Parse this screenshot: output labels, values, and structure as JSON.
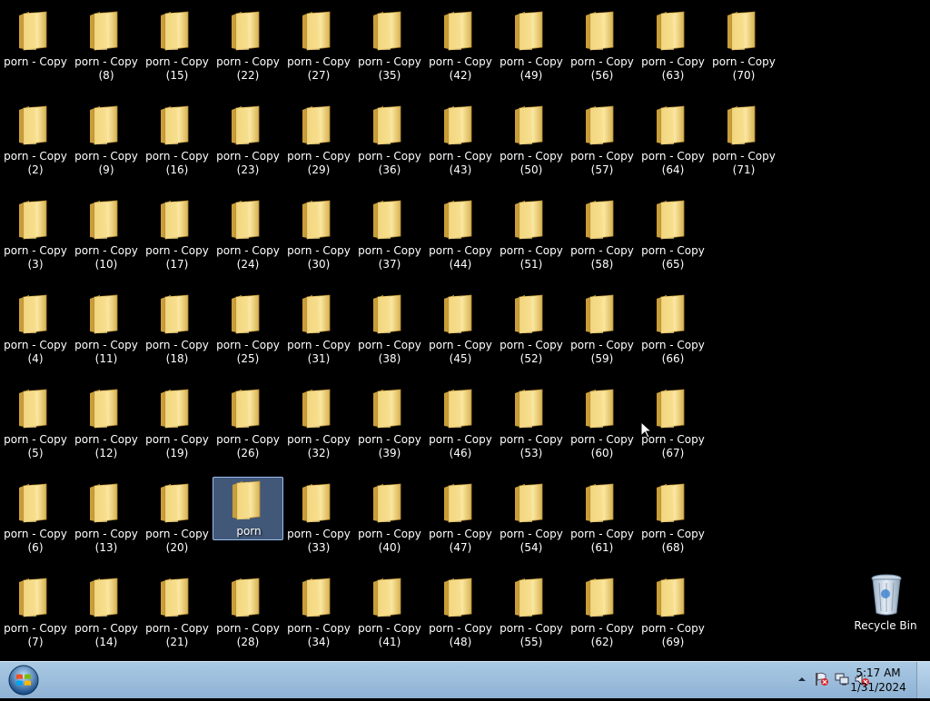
{
  "desktop": {
    "folder_icon": "folder-icon",
    "selected_label": "porn",
    "columns": [
      [
        "porn - Copy",
        "porn - Copy\n(2)",
        "porn - Copy\n(3)",
        "porn - Copy\n(4)",
        "porn - Copy\n(5)",
        "porn - Copy\n(6)",
        "porn - Copy\n(7)"
      ],
      [
        "porn - Copy\n(8)",
        "porn - Copy\n(9)",
        "porn - Copy\n(10)",
        "porn - Copy\n(11)",
        "porn - Copy\n(12)",
        "porn - Copy\n(13)",
        "porn - Copy\n(14)"
      ],
      [
        "porn - Copy\n(15)",
        "porn - Copy\n(16)",
        "porn - Copy\n(17)",
        "porn - Copy\n(18)",
        "porn - Copy\n(19)",
        "porn - Copy\n(20)",
        "porn - Copy\n(21)"
      ],
      [
        "porn - Copy\n(22)",
        "porn - Copy\n(23)",
        "porn - Copy\n(24)",
        "porn - Copy\n(25)",
        "porn - Copy\n(26)",
        "porn",
        "porn - Copy\n(28)"
      ],
      [
        "porn - Copy\n(27)",
        "porn - Copy\n(29)",
        "porn - Copy\n(30)",
        "porn - Copy\n(31)",
        "porn - Copy\n(32)",
        "porn - Copy\n(33)",
        "porn - Copy\n(34)"
      ],
      [
        "porn - Copy\n(35)",
        "porn - Copy\n(36)",
        "porn - Copy\n(37)",
        "porn - Copy\n(38)",
        "porn - Copy\n(39)",
        "porn - Copy\n(40)",
        "porn - Copy\n(41)"
      ],
      [
        "porn - Copy\n(42)",
        "porn - Copy\n(43)",
        "porn - Copy\n(44)",
        "porn - Copy\n(45)",
        "porn - Copy\n(46)",
        "porn - Copy\n(47)",
        "porn - Copy\n(48)"
      ],
      [
        "porn - Copy\n(49)",
        "porn - Copy\n(50)",
        "porn - Copy\n(51)",
        "porn - Copy\n(52)",
        "porn - Copy\n(53)",
        "porn - Copy\n(54)",
        "porn - Copy\n(55)"
      ],
      [
        "porn - Copy\n(56)",
        "porn - Copy\n(57)",
        "porn - Copy\n(58)",
        "porn - Copy\n(59)",
        "porn - Copy\n(60)",
        "porn - Copy\n(61)",
        "porn - Copy\n(62)"
      ],
      [
        "porn - Copy\n(63)",
        "porn - Copy\n(64)",
        "porn - Copy\n(65)",
        "porn - Copy\n(66)",
        "porn - Copy\n(67)",
        "porn - Copy\n(68)",
        "porn - Copy\n(69)"
      ],
      [
        "porn - Copy\n(70)",
        "porn - Copy\n(71)"
      ]
    ],
    "recycle_bin": {
      "label": "Recycle Bin",
      "icon": "recycle-bin-icon"
    }
  },
  "taskbar": {
    "start_icon": "windows-start-icon",
    "tray_icons": [
      "show-hidden-icons-arrow",
      "action-center-flag-icon",
      "network-icon",
      "volume-muted-icon"
    ],
    "clock": {
      "time": "5:17 AM",
      "date": "1/31/2024"
    }
  }
}
